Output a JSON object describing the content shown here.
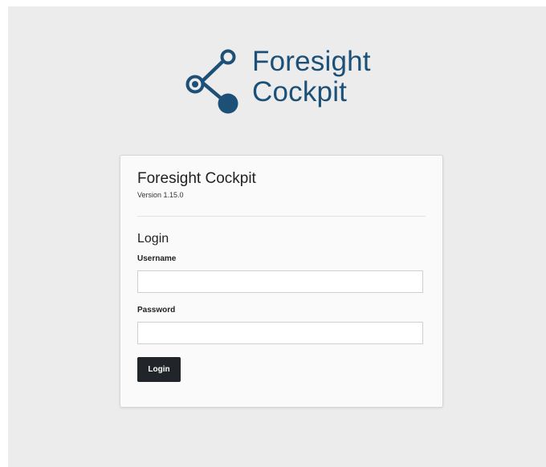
{
  "branding": {
    "logo_icon": "node-graph-icon",
    "logo_line1": "Foresight",
    "logo_line2": "Cockpit",
    "brand_color": "#1d5077"
  },
  "card": {
    "title": "Foresight Cockpit",
    "version": "Version 1.15.0"
  },
  "login_form": {
    "heading": "Login",
    "username_label": "Username",
    "username_value": "",
    "username_placeholder": "",
    "password_label": "Password",
    "password_value": "",
    "password_placeholder": "",
    "submit_label": "Login",
    "button_color": "#212529"
  }
}
